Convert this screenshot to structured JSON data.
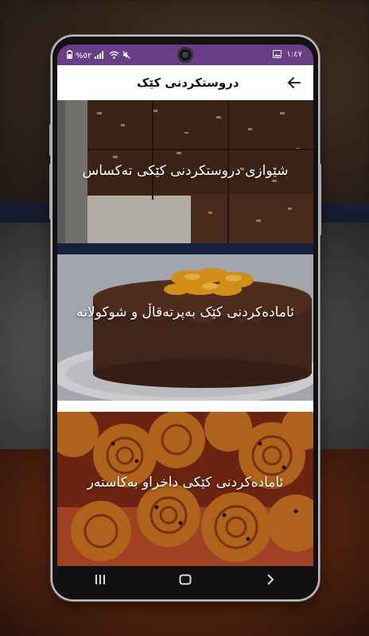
{
  "status_bar": {
    "time": "١:٤٧",
    "battery": "%٥٢",
    "icons": [
      "image-icon",
      "battery-icon",
      "signal-icon",
      "wifi-icon",
      "mute-icon"
    ]
  },
  "app_bar": {
    "title": "دروستکردنی کێک",
    "back_icon": "arrow-back-icon"
  },
  "recipes": [
    {
      "title": "شێوازی دروستکردنی کێکی تەکساس"
    },
    {
      "title": "ئامادەکردنی کێک بەپرتەقاڵ و شوکولاتە"
    },
    {
      "title": "ئامادەکردنی کێکی داخراو بەکاستەر"
    }
  ],
  "nav_bar": {
    "icons": [
      "recent-apps-icon",
      "home-icon",
      "back-chevron-icon"
    ]
  },
  "colors": {
    "status_bar": "#6a3e86",
    "app_bar": "#ffffff",
    "title_text": "#ffffff"
  }
}
